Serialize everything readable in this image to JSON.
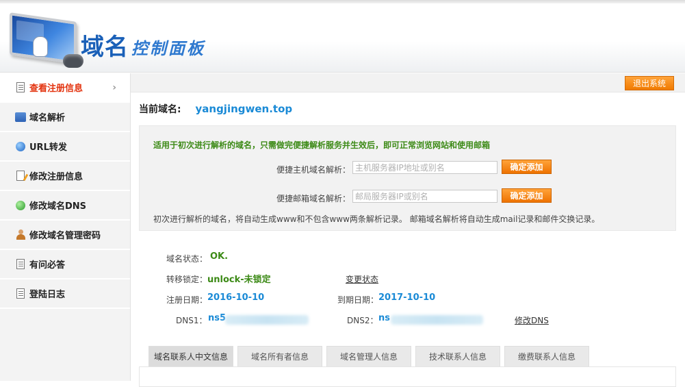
{
  "header": {
    "logo_title": "域名",
    "logo_sub": "控制面板"
  },
  "sidebar": {
    "items": [
      {
        "label": "查看注册信息",
        "icon": "document-icon",
        "active": true
      },
      {
        "label": "域名解析",
        "icon": "network-icon"
      },
      {
        "label": "URL转发",
        "icon": "globe-icon"
      },
      {
        "label": "修改注册信息",
        "icon": "edit-document-icon"
      },
      {
        "label": "修改域名DNS",
        "icon": "dns-icon"
      },
      {
        "label": "修改域名管理密码",
        "icon": "user-icon"
      },
      {
        "label": "有问必答",
        "icon": "document-icon"
      },
      {
        "label": "登陆日志",
        "icon": "document-icon"
      }
    ]
  },
  "topbar": {
    "logout_label": "退出系统"
  },
  "current_domain": {
    "label": "当前域名:",
    "value": "yangjingwen.top"
  },
  "quick": {
    "note": "适用于初次进行解析的域名，只需做完便捷解析服务并生效后，即可正常浏览网站和使用邮箱",
    "host_label": "便捷主机域名解析：",
    "host_placeholder": "主机服务器IP地址或别名",
    "mail_label": "便捷邮箱域名解析：",
    "mail_placeholder": "邮局服务器IP或别名",
    "add_label": "确定添加",
    "footer": "初次进行解析的域名，将自动生成www和不包含www两条解析记录。 邮箱域名解析将自动生成mail记录和邮件交换记录。"
  },
  "info": {
    "status_label": "域名状态：",
    "status_value": "OK.",
    "lock_label": "转移锁定：",
    "lock_value": "unlock-未锁定",
    "change_status": "变更状态",
    "reg_label": "注册日期：",
    "reg_value": "2016-10-10",
    "exp_label": "到期日期：",
    "exp_value": "2017-10-10",
    "dns1_label": "DNS1：",
    "dns1_value": "ns5",
    "dns2_label": "DNS2：",
    "dns2_value": "ns",
    "modify_dns": "修改DNS"
  },
  "tabs": [
    "域名联系人中文信息",
    "域名所有者信息",
    "域名管理人信息",
    "技术联系人信息",
    "缴费联系人信息"
  ]
}
